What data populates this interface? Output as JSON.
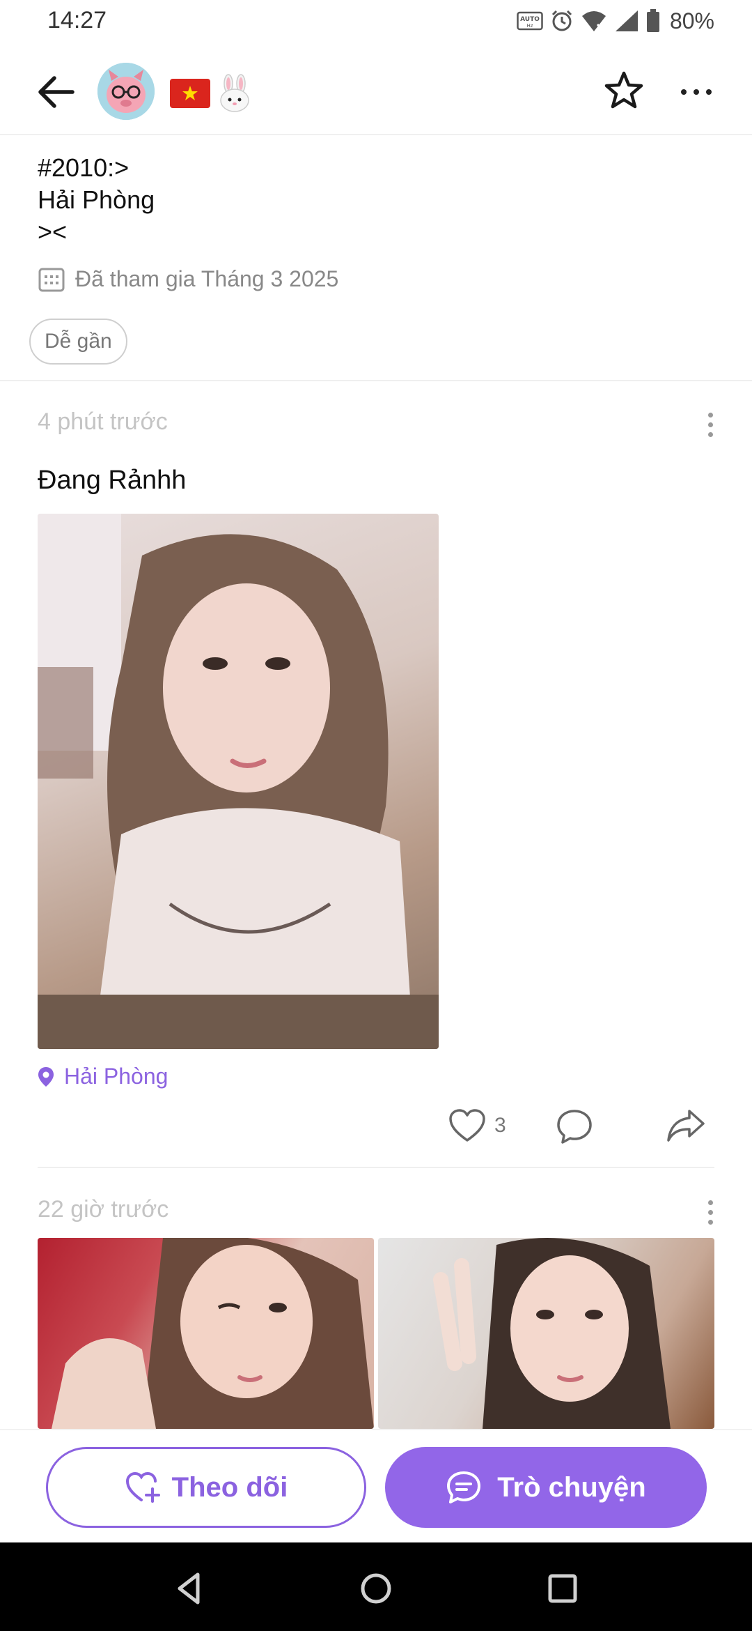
{
  "status_bar": {
    "time": "14:27",
    "battery": "80%",
    "icons": [
      "auto-hz-icon",
      "alarm-icon",
      "wifi-icon",
      "signal-icon",
      "battery-icon"
    ]
  },
  "header": {
    "back_icon": "arrow-left-icon",
    "avatar_icon": "pink-devil-glasses-avatar",
    "badges": [
      "vietnam-flag-icon",
      "bunny-icon"
    ],
    "favorite_icon": "star-icon",
    "more_icon": "more-horizontal-icon"
  },
  "profile": {
    "bio_lines": [
      "#2010:>",
      "Hải Phòng",
      "><"
    ],
    "joined": "Đã tham gia Tháng 3 2025",
    "tag": "Dễ gần"
  },
  "posts": [
    {
      "time": "4 phút trước",
      "text": "Đang Rảnhh",
      "location": "Hải Phòng",
      "likes": "3"
    },
    {
      "time": "22 giờ trước"
    }
  ],
  "bottom_actions": {
    "follow": "Theo dõi",
    "chat": "Trò chuyện"
  },
  "colors": {
    "accent": "#8b62e0",
    "chat_button": "#9266e8",
    "muted_text": "#888888"
  }
}
